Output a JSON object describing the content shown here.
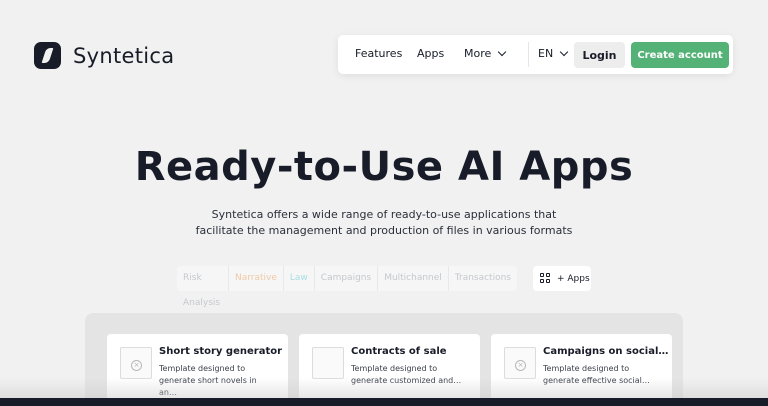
{
  "brand": {
    "name": "Syntetica"
  },
  "nav": {
    "features": "Features",
    "apps": "Apps",
    "more": "More",
    "language": "EN",
    "login": "Login",
    "create_account": "Create account"
  },
  "hero": {
    "title": "Ready-to-Use AI Apps",
    "subtitle_line1": "Syntetica offers a wide range of ready-to-use applications that",
    "subtitle_line2": "facilitate the management and production of files in various formats"
  },
  "filters": [
    "Risk Analysis",
    "Narrative",
    "Law",
    "Campaigns",
    "Multichannel",
    "Transactions"
  ],
  "apps_button": "+ Apps",
  "cards": [
    {
      "title": "Short story generator",
      "desc1": "Template designed to",
      "desc2": "generate short novels in an…",
      "bar_color": "#e8cfe6"
    },
    {
      "title": "Contracts of sale",
      "desc1": "Template designed to",
      "desc2": "generate customized and…",
      "bar_color": "#d3d0d2"
    },
    {
      "title": "Campaigns on social…",
      "desc1": "Template designed to",
      "desc2": "generate effective social…",
      "bar_color": "#e6e6de"
    }
  ],
  "colors": {
    "accent": "#55b276",
    "dark": "#171c28",
    "background": "#f1f1f1"
  }
}
